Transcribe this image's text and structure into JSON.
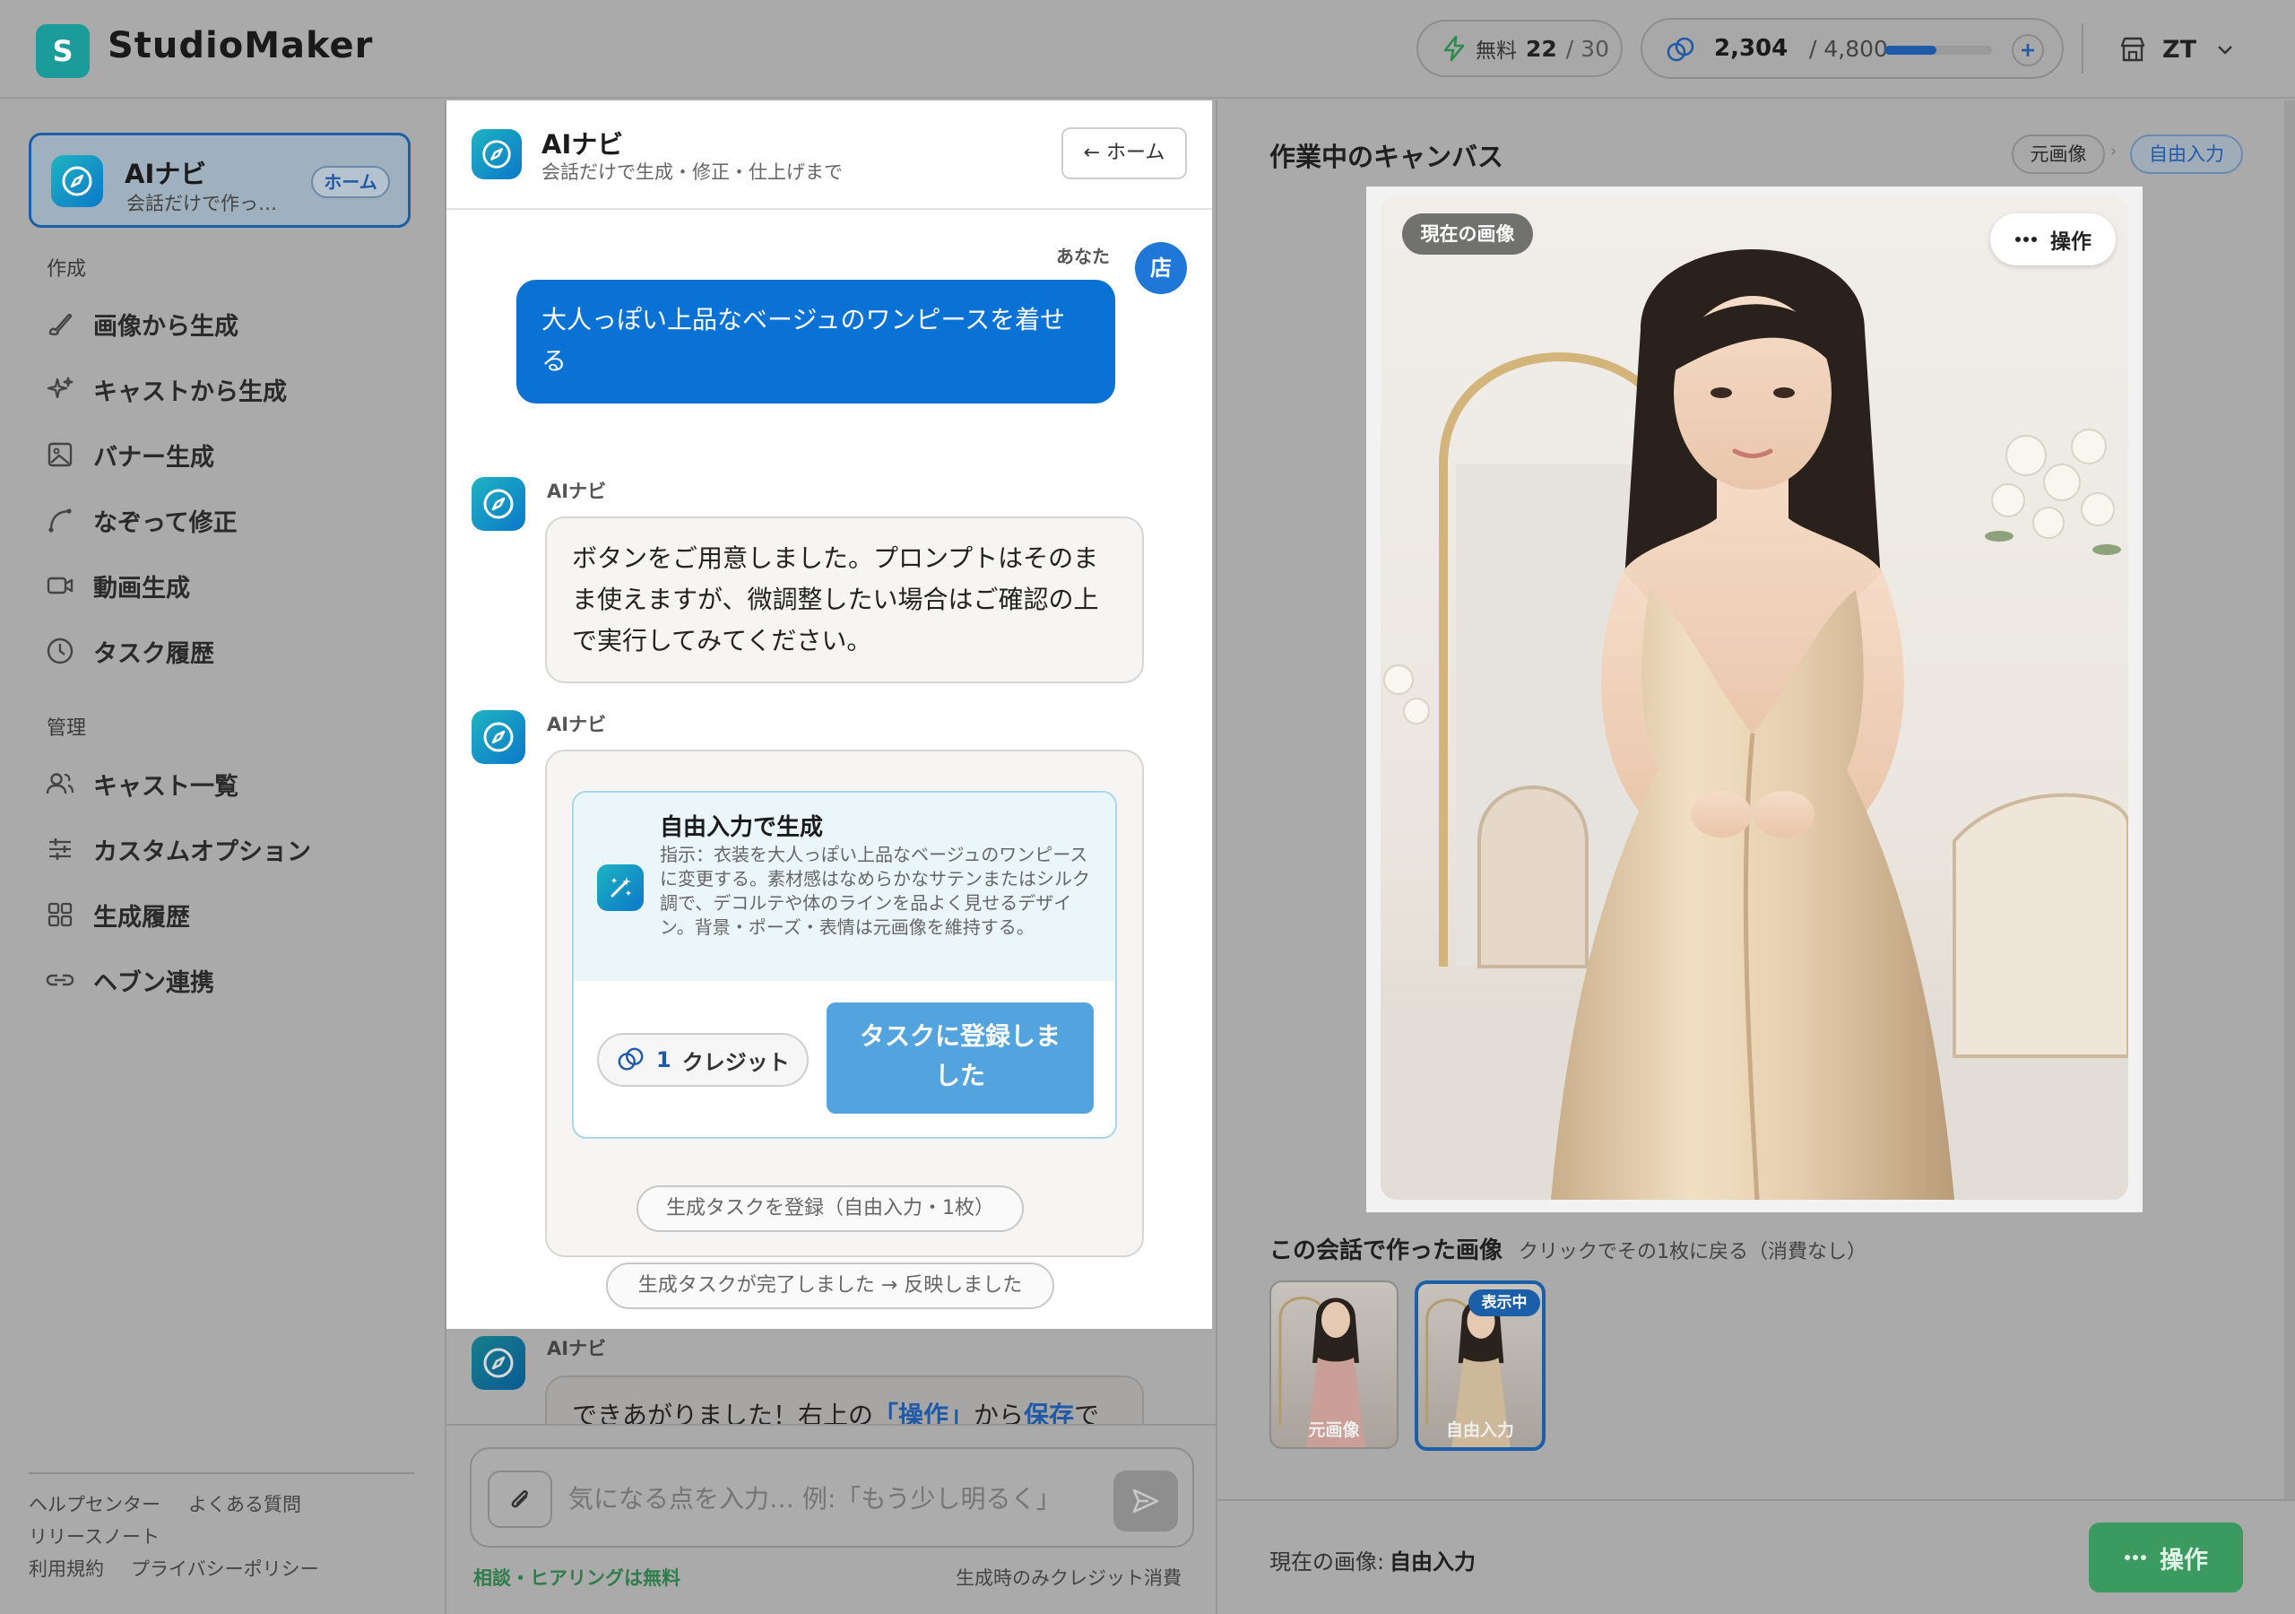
{
  "header": {
    "app_title": "StudioMaker",
    "logo_letter": "S",
    "free_label": "無料",
    "free_used": "22",
    "free_total": "/ 30",
    "credits_value": "2,304",
    "credits_total": "/ 4,800",
    "credits_fraction": 0.48,
    "user_initials": "ZT"
  },
  "sidebar": {
    "home_card": {
      "title": "AIナビ",
      "subtitle": "会話だけで作っ…",
      "badge": "ホーム"
    },
    "section_create": "作成",
    "create_items": [
      {
        "label": "画像から生成",
        "icon": "brush-icon"
      },
      {
        "label": "キャストから生成",
        "icon": "sparkle-icon"
      },
      {
        "label": "バナー生成",
        "icon": "image-icon"
      },
      {
        "label": "なぞって修正",
        "icon": "trace-icon"
      },
      {
        "label": "動画生成",
        "icon": "video-icon"
      },
      {
        "label": "タスク履歴",
        "icon": "clock-icon"
      }
    ],
    "section_manage": "管理",
    "manage_items": [
      {
        "label": "キャスト一覧",
        "icon": "users-icon"
      },
      {
        "label": "カスタムオプション",
        "icon": "sliders-icon"
      },
      {
        "label": "生成履歴",
        "icon": "grid-icon"
      },
      {
        "label": "ヘブン連携",
        "icon": "link-icon"
      }
    ],
    "footer_links": [
      "ヘルプセンター",
      "よくある質問",
      "リリースノート",
      "利用規約",
      "プライバシーポリシー"
    ]
  },
  "chat": {
    "title": "AIナビ",
    "subtitle": "会話だけで生成・修正・仕上げまで",
    "home_button": "← ホーム",
    "user_label": "あなた",
    "user_avatar": "店",
    "user_message": "大人っぽい上品なベージュのワンピースを着せる",
    "ai_label": "AIナビ",
    "ai_message_1": "ボタンをご用意しました。プロンプトはそのまま使えますが、微調整したい場合はご確認の上で実行してみてください。",
    "task_card": {
      "title": "自由入力で生成",
      "description": "指示：衣装を大人っぽい上品なベージュのワンピースに変更する。素材感はなめらかなサテンまたはシルク調で、デコルテや体のラインを品よく見せるデザイン。背景・ポーズ・表情は元画像を維持する。",
      "credit_amount": "1",
      "credit_label": "クレジット",
      "registered_button": "タスクに登録しました"
    },
    "status_chip_1": "生成タスクを登録（自由入力・1枚）",
    "status_chip_2": "生成タスクが完了しました → 反映しました",
    "ai_message_3_pre": "できあがりました！右上の",
    "ai_message_3_link1": "「操作」",
    "ai_message_3_mid": "から",
    "ai_message_3_link2": "保存",
    "ai_message_3_post": "で",
    "input_placeholder": "気になる点を入力… 例:「もう少し明るく」",
    "footer_free": "相談・ヒアリングは無料",
    "footer_credit": "生成時のみクレジット消費"
  },
  "canvas": {
    "title": "作業中のキャンバス",
    "tag_original": "元画像",
    "tag_free": "自由入力",
    "current_badge": "現在の画像",
    "actions_button": "操作",
    "history_title": "この会話で作った画像",
    "history_hint": "クリックでその1枚に戻る（消費なし）",
    "thumbnails": [
      {
        "label": "元画像",
        "badge": ""
      },
      {
        "label": "自由入力",
        "badge": "表示中"
      }
    ],
    "footer_label": "現在の画像:",
    "footer_value": "自由入力",
    "footer_button": "操作"
  },
  "colors": {
    "accent_blue": "#0a72d4",
    "teal": "#1b9c9a",
    "green_button": "#3a9a60",
    "selected_border": "#1b5fa8"
  }
}
